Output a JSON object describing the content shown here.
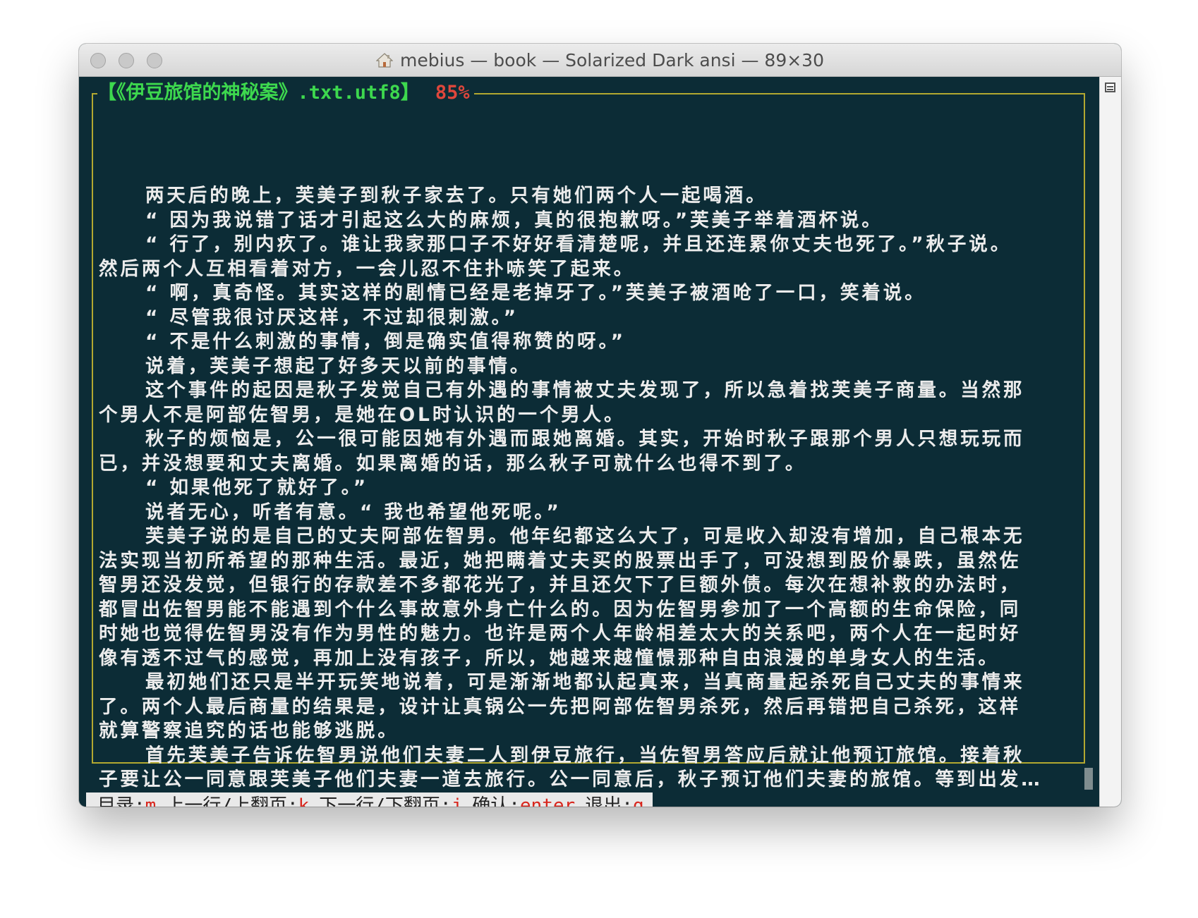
{
  "window": {
    "title": "mebius — book — Solarized Dark ansi — 89×30"
  },
  "reader": {
    "file_label": "【《伊豆旅馆的神秘案》.txt.utf8】",
    "progress": "85%",
    "lines": [
      {
        "text": "两天后的晚上，芙美子到秋子家去了。只有她们两个人一起喝酒。",
        "indent": true
      },
      {
        "text": "“ 因为我说错了话才引起这么大的麻烦，真的很抱歉呀。”芙美子举着酒杯说。",
        "indent": true
      },
      {
        "text": "“ 行了，别内疚了。谁让我家那口子不好好看清楚呢，并且还连累你丈夫也死了。”秋子说。",
        "indent": true
      },
      {
        "text": "然后两个人互相看着对方，一会儿忍不住扑哧笑了起来。",
        "indent": false
      },
      {
        "text": "“ 啊，真奇怪。其实这样的剧情已经是老掉牙了。”芙美子被酒呛了一口，笑着说。",
        "indent": true
      },
      {
        "text": "“ 尽管我很讨厌这样，不过却很刺激。”",
        "indent": true
      },
      {
        "text": "“ 不是什么刺激的事情，倒是确实值得称赞的呀。”",
        "indent": true
      },
      {
        "text": "说着，芙美子想起了好多天以前的事情。",
        "indent": true
      },
      {
        "text": "这个事件的起因是秋子发觉自己有外遇的事情被丈夫发现了，所以急着找芙美子商量。当然那",
        "indent": true
      },
      {
        "text": "个男人不是阿部佐智男，是她在OL时认识的一个男人。",
        "indent": false
      },
      {
        "text": "秋子的烦恼是，公一很可能因她有外遇而跟她离婚。其实，开始时秋子跟那个男人只想玩玩而",
        "indent": true
      },
      {
        "text": "已，并没想要和丈夫离婚。如果离婚的话，那么秋子可就什么也得不到了。",
        "indent": false
      },
      {
        "text": "“ 如果他死了就好了。”",
        "indent": true
      },
      {
        "text": "说者无心，听者有意。“ 我也希望他死呢。”",
        "indent": true
      },
      {
        "text": "芙美子说的是自己的丈夫阿部佐智男。他年纪都这么大了，可是收入却没有增加，自己根本无",
        "indent": true
      },
      {
        "text": "法实现当初所希望的那种生活。最近，她把瞒着丈夫买的股票出手了，可没想到股价暴跌，虽然佐",
        "indent": false
      },
      {
        "text": "智男还没发觉，但银行的存款差不多都花光了，并且还欠下了巨额外债。每次在想补救的办法时，",
        "indent": false
      },
      {
        "text": "都冒出佐智男能不能遇到个什么事故意外身亡什么的。因为佐智男参加了一个高额的生命保险，同",
        "indent": false
      },
      {
        "text": "时她也觉得佐智男没有作为男性的魅力。也许是两个人年龄相差太大的关系吧，两个人在一起时好",
        "indent": false
      },
      {
        "text": "像有透不过气的感觉，再加上没有孩子，所以，她越来越憧憬那种自由浪漫的单身女人的生活。",
        "indent": false
      },
      {
        "text": "最初她们还只是半开玩笑地说着，可是渐渐地都认起真来，当真商量起杀死自己丈夫的事情来",
        "indent": true
      },
      {
        "text": "了。两个人最后商量的结果是，设计让真锅公一先把阿部佐智男杀死，然后再错把自己杀死，这样",
        "indent": false
      },
      {
        "text": "就算警察追究的话也能够逃脱。",
        "indent": false
      },
      {
        "text": "首先芙美子告诉佐智男说他们夫妻二人到伊豆旅行，当佐智男答应后就让他预订旅馆。接着秋",
        "indent": true
      },
      {
        "text": "子要让公一同意跟芙美子他们夫妻一道去旅行。公一同意后，秋子预订他们夫妻的旅馆。等到出发…",
        "indent": false
      }
    ]
  },
  "statusbar": {
    "items": [
      {
        "label": "目录:",
        "key": "m"
      },
      {
        "label": "上一行/上翻页:",
        "key": "k"
      },
      {
        "label": "下一行/下翻页:",
        "key": "j"
      },
      {
        "label": "确认:",
        "key": "enter"
      },
      {
        "label": "退出:",
        "key": "q"
      }
    ]
  },
  "colors": {
    "background": "#0c2c36",
    "frame": "#b3a830",
    "file_label": "#3dd84e",
    "progress": "#e0473c",
    "key": "#d8261d"
  },
  "icons": {
    "title": "home-icon",
    "scroll": "scroll-button-icon"
  }
}
